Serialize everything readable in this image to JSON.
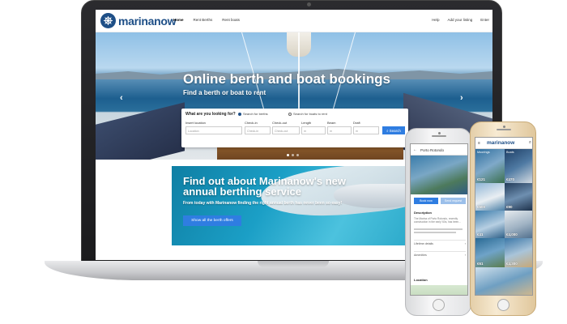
{
  "website": {
    "brand": "marinanow",
    "nav": {
      "links": [
        "Home",
        "Rent Berths",
        "Rent boats"
      ],
      "right_links": [
        "Help",
        "Add your listing",
        "Enter"
      ]
    },
    "hero": {
      "title": "Online berth and boat bookings",
      "subtitle": "Find a berth or boat to rent",
      "prev_arrow": "‹",
      "next_arrow": "›"
    },
    "search": {
      "question": "What are you looking for?",
      "options": [
        {
          "label": "Search for berths",
          "selected": true
        },
        {
          "label": "Search for boats to rent",
          "selected": false
        }
      ],
      "fields": [
        {
          "label": "Insert location",
          "placeholder": "Location"
        },
        {
          "label": "Check-in",
          "placeholder": "Check-in"
        },
        {
          "label": "Check-out",
          "placeholder": "Check-out"
        },
        {
          "label": "Length",
          "placeholder": "m"
        },
        {
          "label": "Beam",
          "placeholder": "m"
        },
        {
          "label": "Draft",
          "placeholder": "m"
        }
      ],
      "button": "Search"
    },
    "promo": {
      "title": "Find out about Marinanow's new annual berthing service",
      "text": "From today with Marinanow finding the right annual berth has never been so easy!",
      "button": "Show all the berth offers"
    }
  },
  "phone_left": {
    "title": "Porto Rotondo",
    "book_button": "Book now",
    "second_button": "Send request",
    "description_heading": "Description",
    "description_line": "The Marina of Porto Rotondo, recently construction in the early '60s, has been...",
    "rows": [
      "Lifetime details",
      "Amenities"
    ],
    "location_heading": "Location"
  },
  "phone_right": {
    "brand": "marinanow",
    "tiles": [
      {
        "label": "Moorings",
        "price": "€121"
      },
      {
        "label": "Boats",
        "price": "€470"
      },
      {
        "label": "",
        "price": "€500"
      },
      {
        "label": "",
        "price": "€90"
      },
      {
        "label": "",
        "price": "€41"
      },
      {
        "label": "",
        "price": "€4,000"
      },
      {
        "label": "",
        "price": "€61"
      },
      {
        "label": "",
        "price": "€4,300"
      }
    ]
  },
  "colors": {
    "brand_blue": "#1e4f87",
    "button_blue": "#2f7de1",
    "promo_teal": "#1b9fc6"
  }
}
